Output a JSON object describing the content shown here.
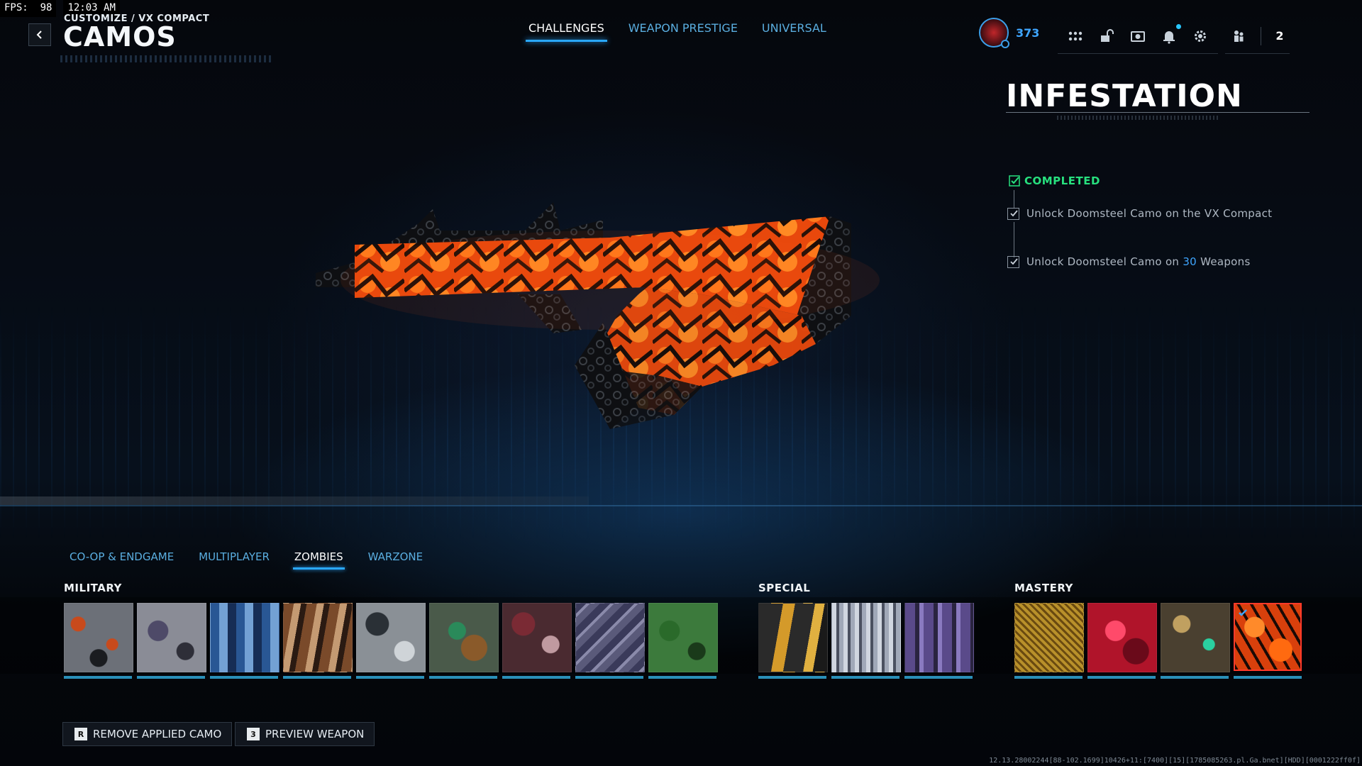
{
  "debug": {
    "fps_label": "FPS:",
    "fps_value": "98",
    "clock": "12:03 AM"
  },
  "header": {
    "breadcrumb": "CUSTOMIZE / VX COMPACT",
    "title": "CAMOS"
  },
  "top_tabs": [
    {
      "label": "CHALLENGES",
      "active": true
    },
    {
      "label": "WEAPON PRESTIGE",
      "active": false
    },
    {
      "label": "UNIVERSAL",
      "active": false
    }
  ],
  "hud": {
    "rank_value": "373",
    "icons": [
      "apps-grid-icon",
      "unlock-icon",
      "camera-icon",
      "notification-bell-icon",
      "settings-gear-icon"
    ],
    "party_count": "2"
  },
  "camo": {
    "name": "INFESTATION",
    "status": "COMPLETED",
    "status_color": "#27e07e",
    "challenges": [
      {
        "text": "Unlock Doomsteel Camo on the VX Compact",
        "done": true
      },
      {
        "pre": "Unlock Doomsteel Camo on ",
        "highlight": "30",
        "post": " Weapons",
        "done": true
      }
    ]
  },
  "mode_tabs": [
    {
      "label": "CO-OP & ENDGAME",
      "active": false
    },
    {
      "label": "MULTIPLAYER",
      "active": false
    },
    {
      "label": "ZOMBIES",
      "active": true
    },
    {
      "label": "WARZONE",
      "active": false
    }
  ],
  "sections": {
    "military": "MILITARY",
    "special": "SPECIAL",
    "mastery": "MASTERY"
  },
  "actions": {
    "remove_key": "R",
    "remove_label": "REMOVE APPLIED CAMO",
    "preview_key": "3",
    "preview_label": "PREVIEW WEAPON"
  },
  "build_info": "12.13.28002244[88-102.1699]10426+11:[7400][15][1785085263.pl.Ga.bnet][HDD][0001222ff0f]",
  "colors": {
    "accent": "#2aa8ff",
    "complete": "#27e07e",
    "selected_border": "#ff3a2a"
  }
}
